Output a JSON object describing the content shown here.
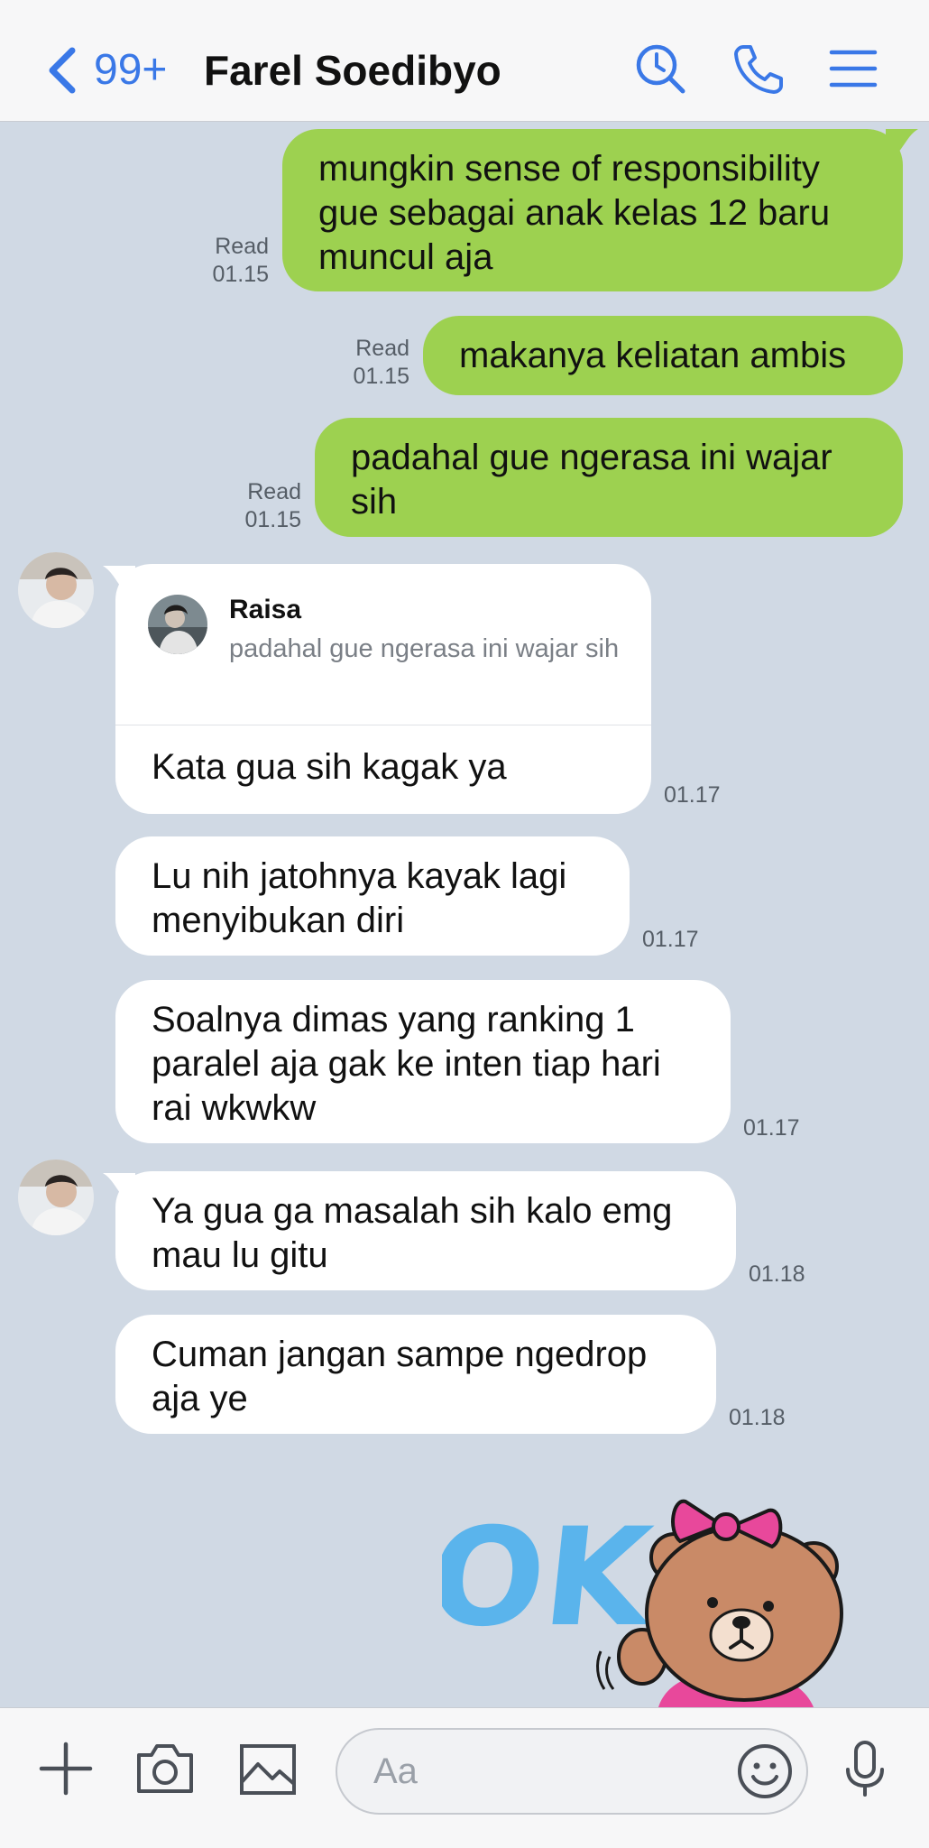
{
  "header": {
    "unread_badge": "99+",
    "contact_name": "Farel Soedibyo"
  },
  "messages": [
    {
      "side": "out",
      "lines": [
        "mungkin sense of responsibility",
        "gue sebagai anak kelas 12 baru",
        "muncul aja"
      ],
      "read_label": "Read",
      "time": "01.15"
    },
    {
      "side": "out",
      "lines": [
        "makanya keliatan ambis"
      ],
      "read_label": "Read",
      "time": "01.15"
    },
    {
      "side": "out",
      "lines": [
        "padahal gue ngerasa ini wajar",
        "sih"
      ],
      "read_label": "Read",
      "time": "01.15"
    },
    {
      "side": "in",
      "reply": {
        "name": "Raisa",
        "quoted": "padahal gue ngerasa ini wajar sih"
      },
      "lines": [
        "Kata gua sih kagak ya"
      ],
      "time": "01.17"
    },
    {
      "side": "in",
      "lines": [
        "Lu nih jatohnya kayak lagi",
        "menyibukan diri"
      ],
      "time": "01.17"
    },
    {
      "side": "in",
      "lines": [
        "Soalnya dimas yang ranking 1",
        "paralel aja gak ke inten tiap hari",
        "rai wkwkw"
      ],
      "time": "01.17"
    },
    {
      "side": "in",
      "lines": [
        "Ya gua ga masalah sih kalo emg",
        "mau lu gitu"
      ],
      "time": "01.18"
    },
    {
      "side": "in",
      "lines": [
        "Cuman jangan sampe ngedrop",
        "aja ye"
      ],
      "time": "01.18"
    }
  ],
  "sticker": {
    "text": "OK!"
  },
  "input": {
    "placeholder": "Aa"
  },
  "icons": {
    "back": "chevron-left-icon",
    "search": "search-clock-icon",
    "call": "phone-icon",
    "menu": "hamburger-icon",
    "add": "plus-icon",
    "camera": "camera-icon",
    "gallery": "image-icon",
    "emoji": "smiley-icon",
    "voice": "microphone-icon"
  },
  "colors": {
    "accent": "#3a78e7",
    "outgoing_bubble": "#9dd150",
    "incoming_bubble": "#ffffff",
    "chat_background": "#d0d9e4"
  }
}
